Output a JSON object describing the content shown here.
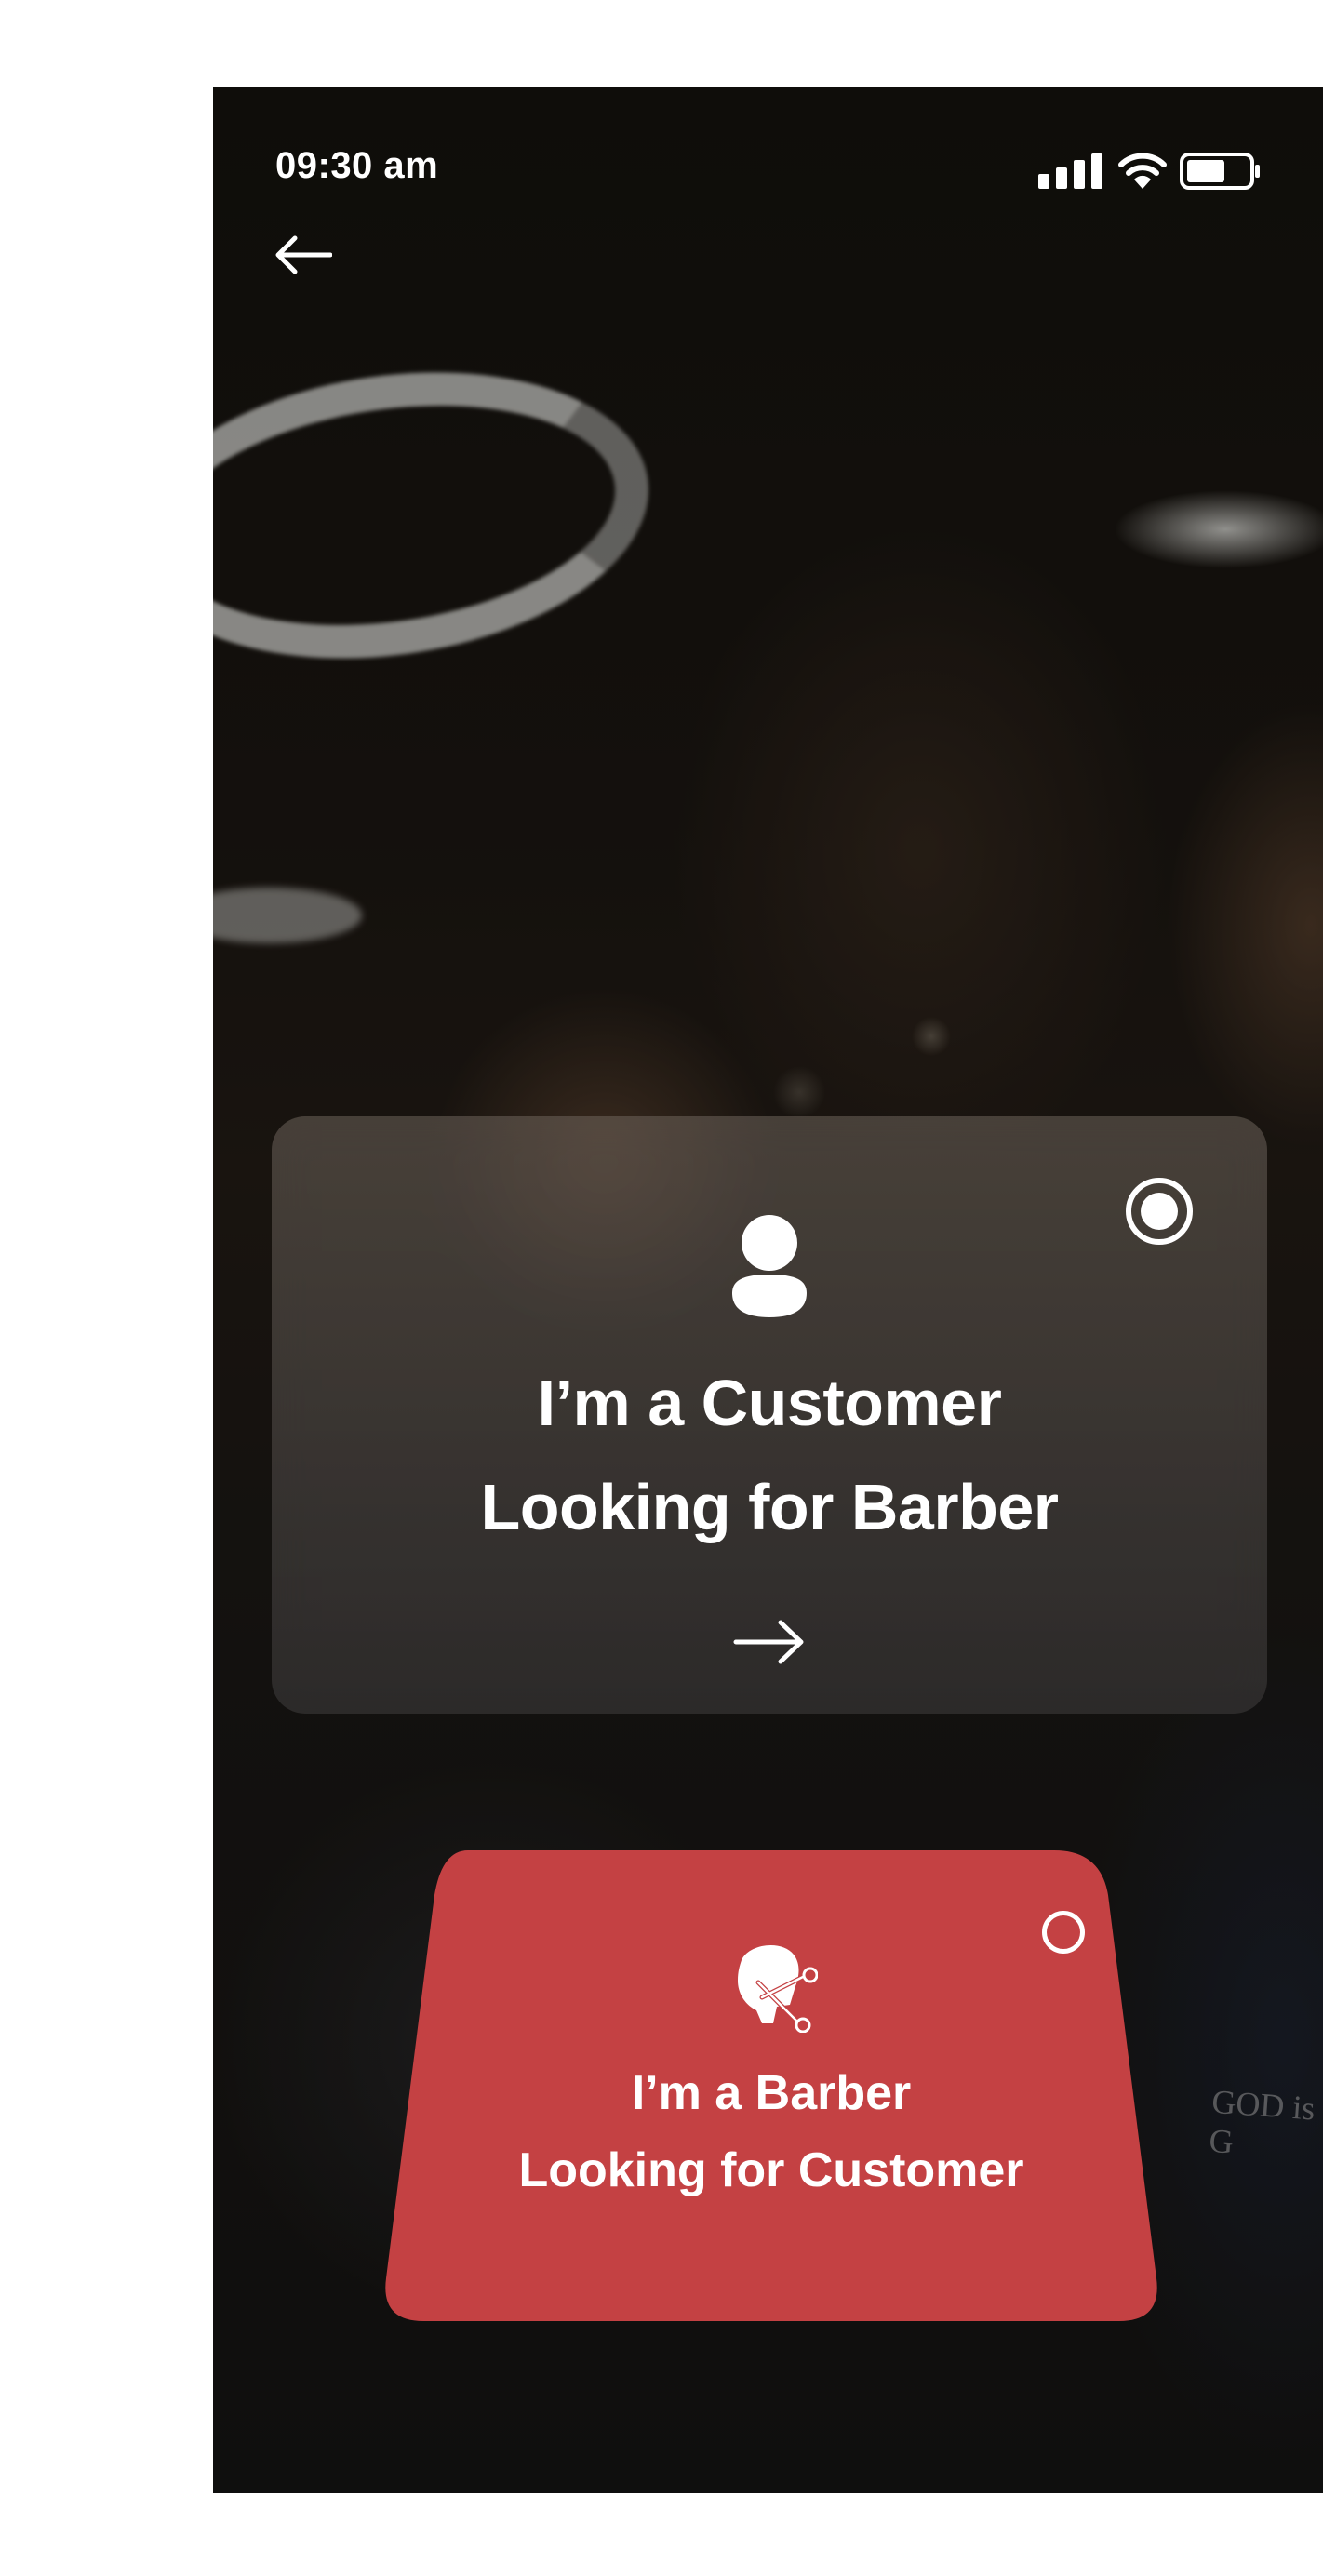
{
  "status_bar": {
    "time": "09:30 am",
    "signal_icon": "signal-bars-icon",
    "wifi_icon": "wifi-icon",
    "battery_icon": "battery-icon"
  },
  "nav": {
    "back_icon": "arrow-left-icon"
  },
  "roles": {
    "customer": {
      "icon": "person-icon",
      "title_line1": "I’m a Customer",
      "title_line2": "Looking for Barber",
      "selected": true,
      "action_icon": "arrow-right-icon"
    },
    "barber": {
      "icon": "barber-scissors-icon",
      "title_line1": "I’m a Barber",
      "title_line2": "Looking for Customer",
      "selected": false
    }
  },
  "background": {
    "apron_text": "GOD is G"
  },
  "colors": {
    "accent_red": "#C44143",
    "white": "#FFFFFF"
  }
}
